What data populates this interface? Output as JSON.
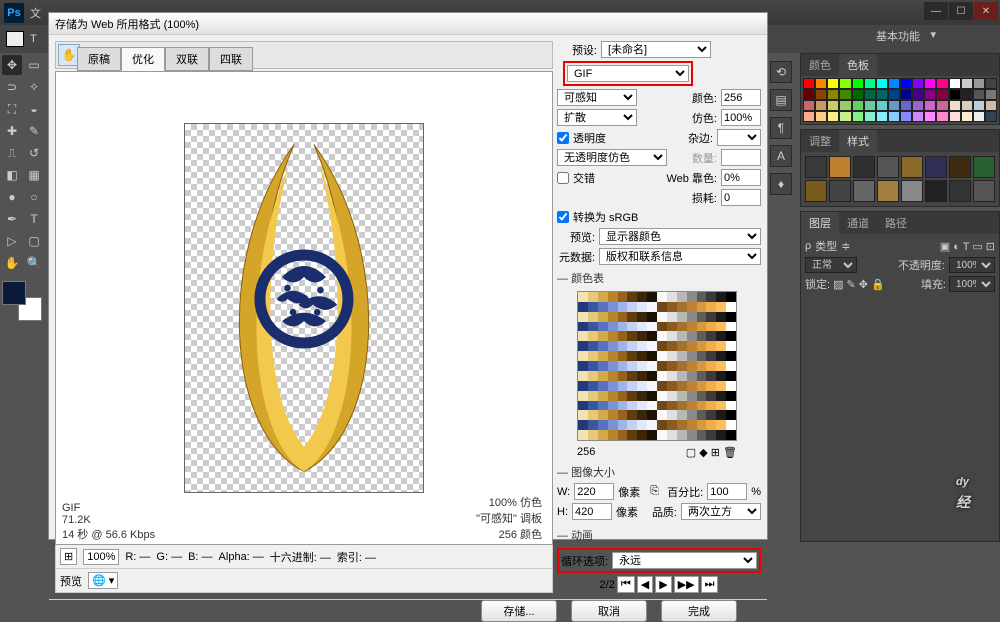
{
  "app": {
    "title_prefix": "Ps",
    "menu": [
      "文"
    ],
    "workspace": "基本功能"
  },
  "options_bar": {
    "tool_char": "T"
  },
  "dialog": {
    "title": "存储为 Web 所用格式 (100%)",
    "tabs": [
      "原稿",
      "优化",
      "双联",
      "四联"
    ],
    "active_tab": 1,
    "footer": {
      "zoom": "100%",
      "r": "R: —",
      "g": "G: —",
      "b": "B: —",
      "alpha": "Alpha: —",
      "hex": "十六进制: —",
      "index": "索引: —",
      "preview_label": "预览"
    },
    "preview_stats": {
      "format": "GIF",
      "size": "71.2K",
      "time": "14 秒 @ 56.6 Kbps",
      "quality": "100% 仿色",
      "palette": "\"可感知\" 调板",
      "colors": "256 颜色"
    },
    "right": {
      "preset_label": "预设:",
      "preset_value": "[未命名]",
      "format": "GIF",
      "reduction": "可感知",
      "colors_label": "颜色:",
      "colors_value": "256",
      "dither_method": "扩散",
      "dither_label": "仿色:",
      "dither_value": "100%",
      "transparency_label": "透明度",
      "matte_label": "杂边:",
      "trans_dither": "无透明度仿色",
      "trans_amount_label": "数量:",
      "interlaced_label": "交错",
      "websnap_label": "Web 靠色:",
      "websnap_value": "0%",
      "lossy_label": "损耗:",
      "lossy_value": "0",
      "convert_srgb": "转换为 sRGB",
      "preview_profile_label": "预览:",
      "preview_profile": "显示器颜色",
      "metadata_label": "元数据:",
      "metadata_value": "版权和联系信息",
      "colortable_label": "颜色表",
      "colortable_count": "256",
      "imagesize_label": "图像大小",
      "w_label": "W:",
      "w_value": "220",
      "h_label": "H:",
      "h_value": "420",
      "px_label": "像素",
      "percent_label": "百分比:",
      "percent_value": "100",
      "pct": "%",
      "quality_label": "品质:",
      "quality_value": "两次立方",
      "animation_label": "动画",
      "loop_label": "循环选项:",
      "loop_value": "永远",
      "frame_counter": "2/2"
    },
    "buttons": {
      "save": "存储...",
      "cancel": "取消",
      "done": "完成"
    }
  },
  "panels": {
    "color_tab": "颜色",
    "swatches_tab": "色板",
    "adjust_tab": "调整",
    "styles_tab": "样式",
    "layers_tab": "图层",
    "channels_tab": "通道",
    "paths_tab": "路径",
    "layers": {
      "kind": "类型",
      "blend": "正常",
      "opacity_label": "不透明度:",
      "opacity_val": "100%",
      "lock_label": "锁定:",
      "fill_label": "填充:",
      "fill_val": "100%"
    }
  },
  "iconcol": [
    "⟲",
    "▤",
    "¶",
    "A",
    "♦"
  ],
  "watermark": {
    "brand": "dy",
    "sub": "经"
  },
  "swatch_colors": [
    "#ff0000",
    "#ff8800",
    "#ffff00",
    "#88ff00",
    "#00ff00",
    "#00ff88",
    "#00ffff",
    "#0088ff",
    "#0000ff",
    "#8800ff",
    "#ff00ff",
    "#ff0088",
    "#ffffff",
    "#cccccc",
    "#999999",
    "#444444",
    "#660000",
    "#884400",
    "#888800",
    "#448800",
    "#006600",
    "#006644",
    "#006666",
    "#004488",
    "#000088",
    "#440088",
    "#880088",
    "#880044",
    "#000000",
    "#222222",
    "#555555",
    "#777777",
    "#cc6666",
    "#cc9966",
    "#cccc66",
    "#99cc66",
    "#66cc66",
    "#66cc99",
    "#66cccc",
    "#6699cc",
    "#6666cc",
    "#9966cc",
    "#cc66cc",
    "#cc6699",
    "#eeddcc",
    "#ddccbb",
    "#bbccdd",
    "#ccbbaa",
    "#ffaa88",
    "#ffcc88",
    "#ffee88",
    "#ccee88",
    "#88ee88",
    "#88eecc",
    "#88eeff",
    "#88ccff",
    "#8888ff",
    "#cc88ff",
    "#ff88ff",
    "#ff88cc",
    "#ffdddd",
    "#ffeecc",
    "#eeeeee",
    "#334455"
  ],
  "style_colors": [
    "#3a3a3a",
    "#c08030",
    "#303030",
    "#555",
    "#8a6a2a",
    "#303056",
    "#402a10",
    "#286030",
    "#7a5a1a",
    "#444",
    "#666",
    "#a08040",
    "#888",
    "#222",
    "#333",
    "#555"
  ],
  "ct_colors": [
    "#f4e3b2",
    "#e8c878",
    "#d4a947",
    "#b8862a",
    "#97631a",
    "#5f3e0e",
    "#3d2607",
    "#1c1203",
    "#fafafa",
    "#e0e0e0",
    "#b8b8b8",
    "#8a8a8a",
    "#5c5c5c",
    "#3a3a3a",
    "#1a1a1a",
    "#000",
    "#223a7a",
    "#3a56a0",
    "#5672c0",
    "#7a92d8",
    "#a0b4e8",
    "#c4d0f4",
    "#e0e8fa",
    "#f4f6fd",
    "#704818",
    "#8a5c22",
    "#a4702c",
    "#be8436",
    "#d89840",
    "#f2ac4a",
    "#fcc060",
    "#fff"
  ]
}
